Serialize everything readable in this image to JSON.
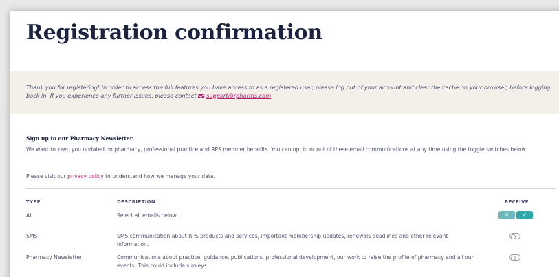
{
  "page": {
    "title": "Registration confirmation"
  },
  "notice": {
    "text": "Thank you for registering! In order to access the full features you have access to as a registered user, please log out of your account and clear the cache on your browser, before logging back in. If you experience any further issues, please contact ",
    "email": "support@rpharms.com",
    "icon": "mail-icon",
    "link_color": "#b0276f"
  },
  "newsletter": {
    "heading": "Sign up to our Pharmacy Newsletter",
    "description": "We want to keep you updated on pharmacy, professional practice and RPS member benefits. You can opt in or out of these email communications at any time using the toggle switches below.",
    "privacy_prefix": "Please visit our ",
    "privacy_link": "privacy policy",
    "privacy_suffix": " to understand how we manage your data."
  },
  "table": {
    "headers": {
      "type": "TYPE",
      "description": "DESCRIPTION",
      "receive": "RECEIVE"
    },
    "rows": [
      {
        "type": "All",
        "description": "Select all emails below.",
        "control": "toggle-pair"
      },
      {
        "type": "SMS",
        "description": "SMS communication about RPS products and services, important membership updates, renewals deadlines and other relevant information.",
        "control": "switch",
        "on": false
      },
      {
        "type": "Pharmacy Newsletter",
        "description": "Communications about practice, guidance, publications, professional development, our work to raise the profile of pharmacy and all our events. This could include surveys.",
        "control": "switch",
        "on": false
      }
    ],
    "toggle": {
      "off_glyph": "✕",
      "on_glyph": "✓",
      "accent": "#2fa6a8"
    }
  }
}
